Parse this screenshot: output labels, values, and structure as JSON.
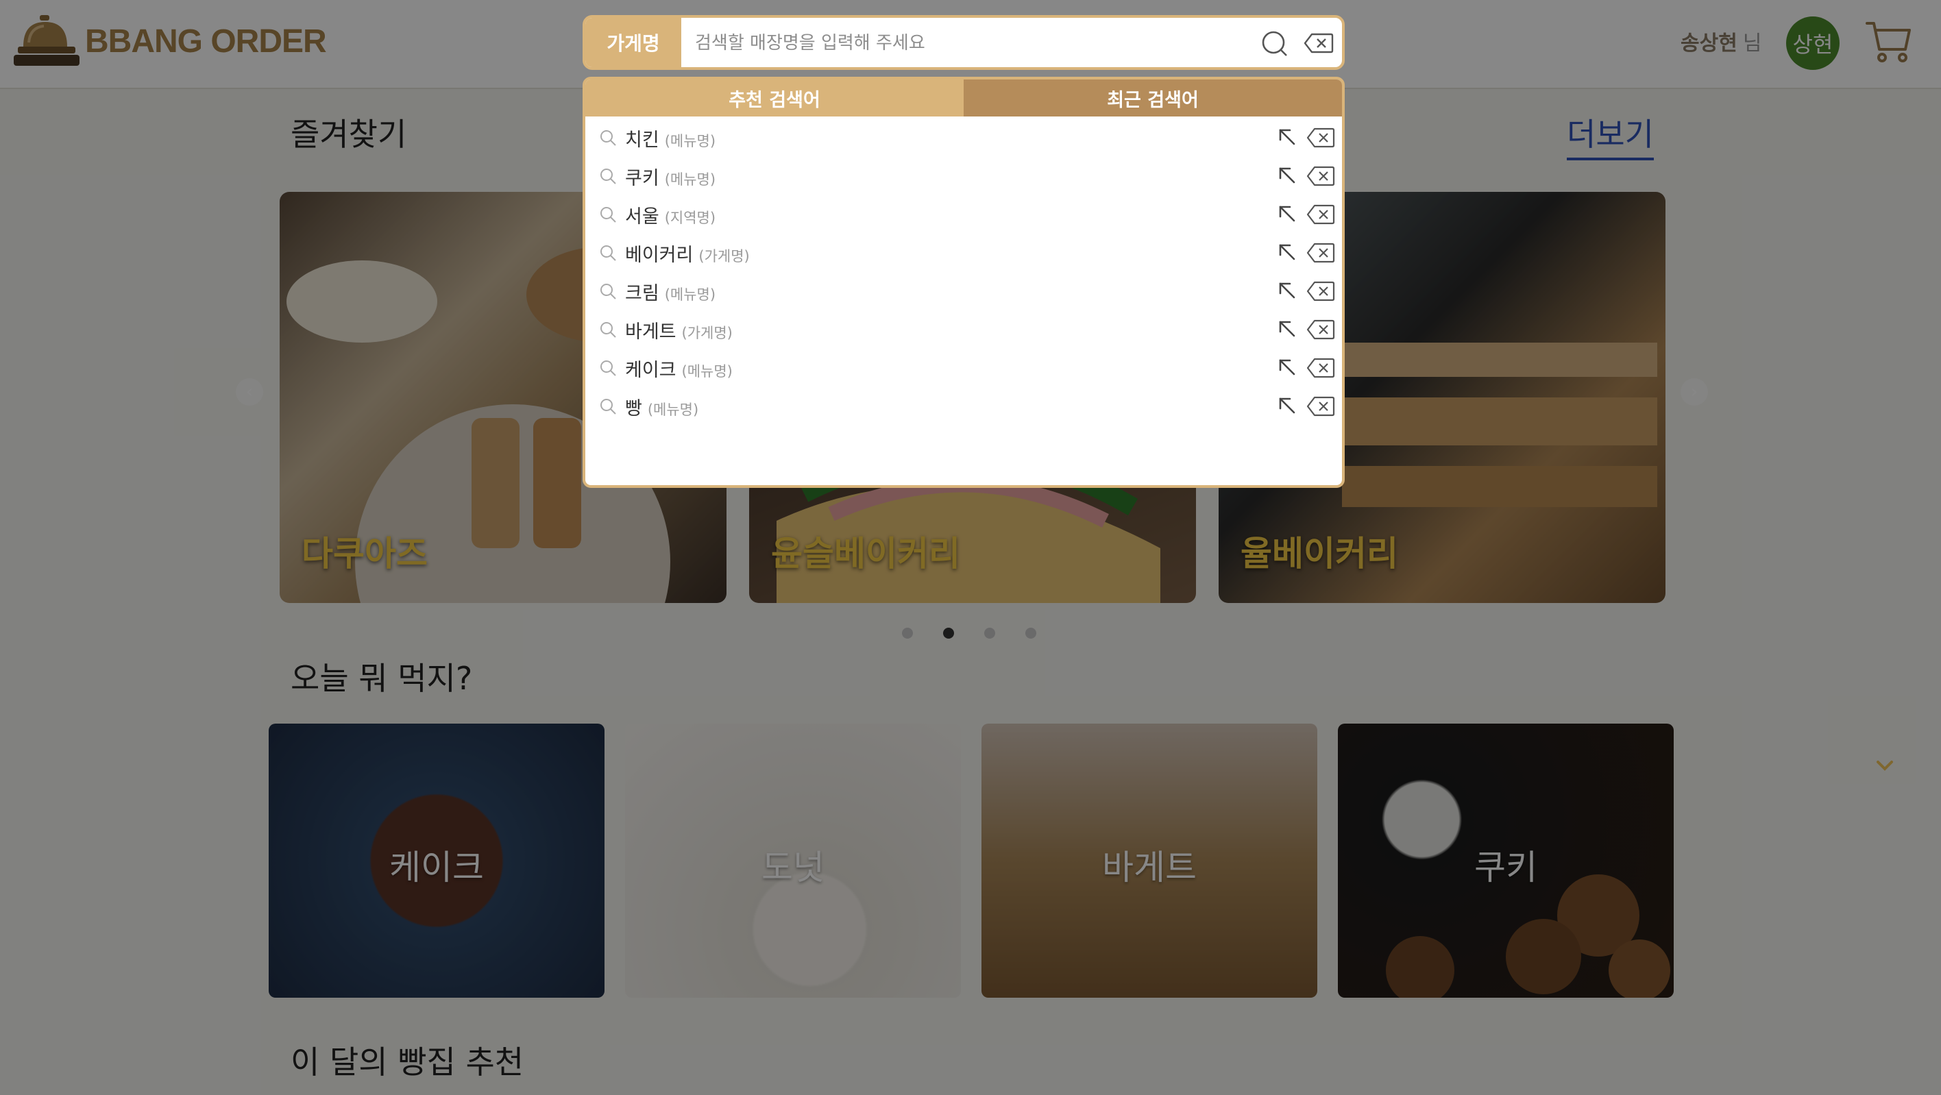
{
  "brand": {
    "name": "BBANG ORDER"
  },
  "user": {
    "name": "송상현",
    "suffix": "님",
    "avatar_text": "상현"
  },
  "favorites": {
    "title": "즐겨찾기",
    "more_label": "더보기",
    "cards": [
      {
        "name": "다쿠아즈"
      },
      {
        "name": "윤슬베이커리"
      },
      {
        "name": "율베이커리"
      }
    ],
    "carousel_pages": 4,
    "active_page": 2
  },
  "today": {
    "title": "오늘 뭐 먹지?",
    "tiles": [
      {
        "name": "케이크"
      },
      {
        "name": "도넛"
      },
      {
        "name": "바게트"
      },
      {
        "name": "쿠키"
      }
    ]
  },
  "monthly": {
    "title": "이 달의 빵집 추천"
  },
  "search": {
    "category_label": "가게명",
    "placeholder": "검색할 매장명을 입력해 주세요",
    "value": "",
    "tabs": [
      {
        "label": "추천 검색어"
      },
      {
        "label": "최근 검색어"
      }
    ],
    "suggestions": [
      {
        "word": "치킨",
        "type": "(메뉴명)"
      },
      {
        "word": "쿠키",
        "type": "(메뉴명)"
      },
      {
        "word": "서울",
        "type": "(지역명)"
      },
      {
        "word": "베이커리",
        "type": "(가게명)"
      },
      {
        "word": "크림",
        "type": "(메뉴명)"
      },
      {
        "word": "바게트",
        "type": "(가게명)"
      },
      {
        "word": "케이크",
        "type": "(메뉴명)"
      },
      {
        "word": "빵",
        "type": "(메뉴명)"
      }
    ]
  },
  "colors": {
    "accent": "#d9b47a",
    "accent_dark": "#b58c5a",
    "avatar": "#4d8a2d",
    "link": "#3052b8",
    "brand_text": "#a7824a"
  }
}
